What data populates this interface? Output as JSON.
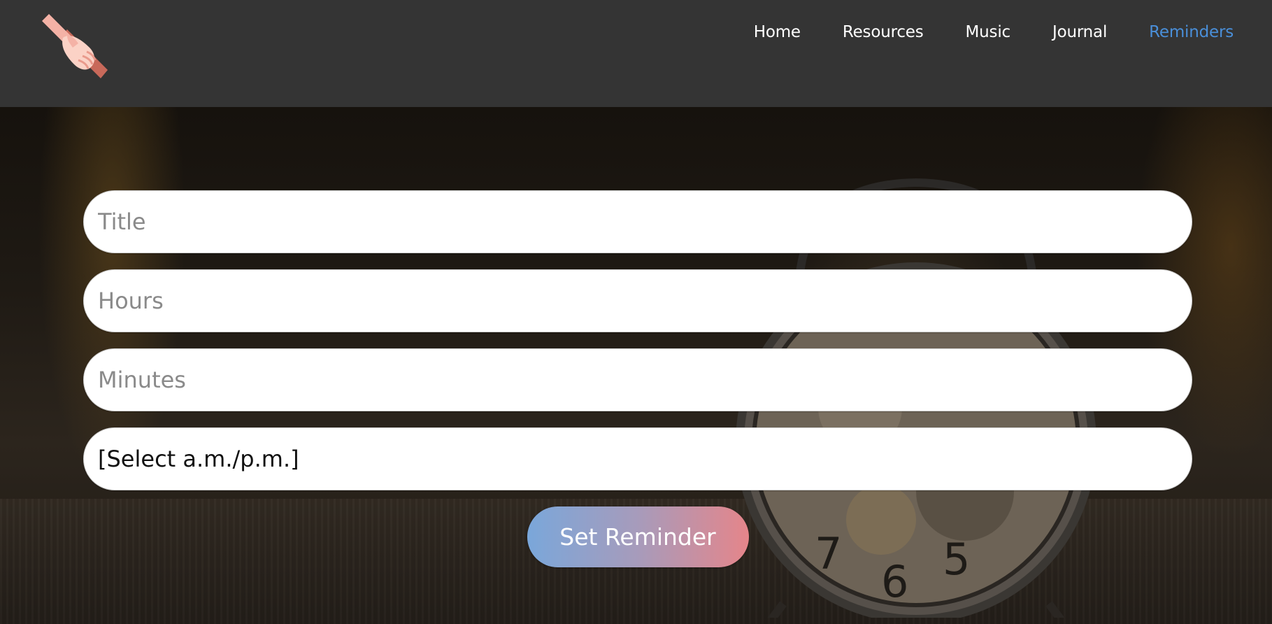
{
  "nav": {
    "items": [
      {
        "label": "Home",
        "active": false
      },
      {
        "label": "Resources",
        "active": false
      },
      {
        "label": "Music",
        "active": false
      },
      {
        "label": "Journal",
        "active": false
      },
      {
        "label": "Reminders",
        "active": true
      }
    ]
  },
  "logo": {
    "icon": "helping-hands-icon"
  },
  "form": {
    "title_placeholder": "Title",
    "hours_placeholder": "Hours",
    "minutes_placeholder": "Minutes",
    "ampm_selected": "[Select a.m./p.m.]",
    "submit_label": "Set Reminder"
  },
  "colors": {
    "header_bg": "#343434",
    "active_nav": "#4a8fd9",
    "button_gradient_start": "#7aa7da",
    "button_gradient_end": "#e5858a"
  },
  "background": {
    "icon": "alarm-clock-photo"
  }
}
